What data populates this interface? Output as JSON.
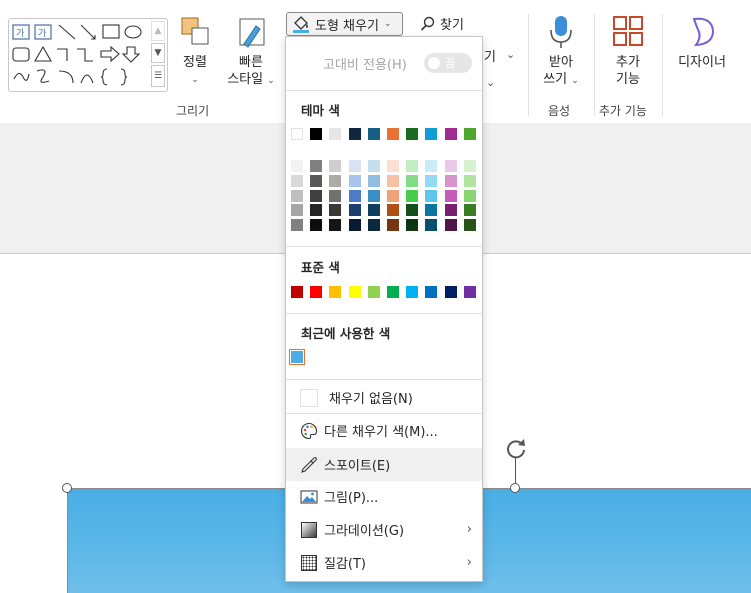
{
  "ribbon": {
    "draw_group": {
      "label": "그리기",
      "arrange_label": "정렬",
      "quick_styles_label_1": "빠른",
      "quick_styles_label_2": "스타일"
    },
    "fill_button_label": "도형 채우기",
    "find_label": "찾기",
    "voice_group": {
      "label": "음성",
      "dictate_label_1": "받아",
      "dictate_label_2": "쓰기"
    },
    "addins_group": {
      "label": "추가 기능",
      "button_label_1": "추가",
      "button_label_2": "기능"
    },
    "designer_label": "디자이너"
  },
  "fill_menu": {
    "high_contrast_label": "고대비 전용(H)",
    "high_contrast_toggle": "끔",
    "theme_colors_heading": "테마 색",
    "theme_top_row": [
      "#ffffff",
      "#000000",
      "#e7e6e6",
      "#0e2841",
      "#156082",
      "#e97132",
      "#196b24",
      "#0f9ed5",
      "#a02b93",
      "#4ea72e"
    ],
    "theme_shades": [
      [
        "#f2f2f2",
        "#d9d9d9",
        "#bfbfbf",
        "#a6a6a6",
        "#808080"
      ],
      [
        "#808080",
        "#595959",
        "#404040",
        "#262626",
        "#0d0d0d"
      ],
      [
        "#d0cece",
        "#aeaaaa",
        "#757070",
        "#3b3838",
        "#171616"
      ],
      [
        "#d9e2f3",
        "#a9c4ea",
        "#4d7bc5",
        "#1c3e6e",
        "#0b1a31"
      ],
      [
        "#c6dfef",
        "#8ebfe0",
        "#3b8fc4",
        "#103f5d",
        "#082a3e"
      ],
      [
        "#fbe0d2",
        "#f6c0a4",
        "#f0a176",
        "#b14f16",
        "#75350f"
      ],
      [
        "#c1eec2",
        "#83dd86",
        "#46cc4b",
        "#134f1b",
        "#0d3512"
      ],
      [
        "#c9ecf8",
        "#93d9f2",
        "#5cc6ec",
        "#0b769f",
        "#074f6a"
      ],
      [
        "#ecc9e7",
        "#d993cf",
        "#c65cb8",
        "#78206e",
        "#501649"
      ],
      [
        "#d8f1d0",
        "#b1e3a1",
        "#8ad572",
        "#3a7d22",
        "#275317"
      ]
    ],
    "standard_colors_heading": "표준 색",
    "standard_colors": [
      "#c00000",
      "#ff0000",
      "#ffc000",
      "#ffff00",
      "#92d050",
      "#00b050",
      "#00b0f0",
      "#0070c0",
      "#002060",
      "#7030a0"
    ],
    "recent_colors_heading": "최근에 사용한 색",
    "recent_colors": [
      "#4aaee5"
    ],
    "items": {
      "no_fill": "채우기 없음(N)",
      "more_colors": "다른 채우기 색(M)...",
      "eyedropper": "스포이트(E)",
      "picture": "그림(P)...",
      "gradient": "그라데이션(G)",
      "texture": "질감(T)"
    }
  }
}
